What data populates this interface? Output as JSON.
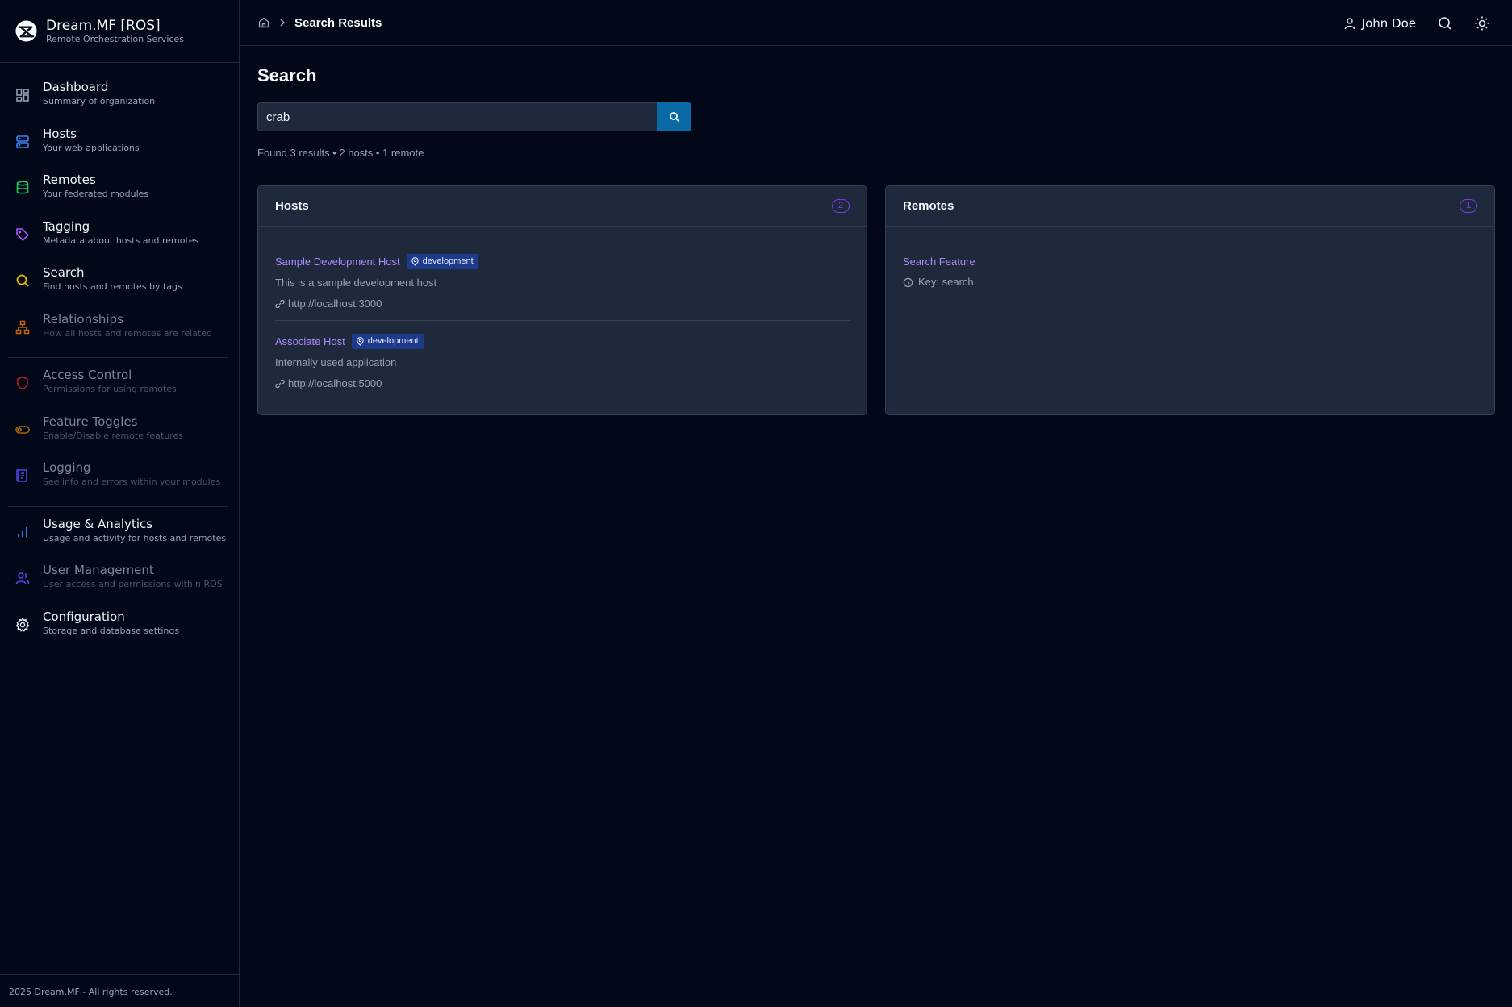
{
  "brand": {
    "title": "Dream.MF [ROS]",
    "subtitle": "Remote Orchestration Services"
  },
  "sidebar": {
    "items": [
      {
        "label": "Dashboard",
        "sub": "Summary of organization",
        "icon": "dashboard-icon",
        "color": "#94a3b8"
      },
      {
        "label": "Hosts",
        "sub": "Your web applications",
        "icon": "server-icon",
        "color": "#3b82f6"
      },
      {
        "label": "Remotes",
        "sub": "Your federated modules",
        "icon": "database-icon",
        "color": "#22c55e"
      },
      {
        "label": "Tagging",
        "sub": "Metadata about hosts and remotes",
        "icon": "tag-icon",
        "color": "#a855f7"
      },
      {
        "label": "Search",
        "sub": "Find hosts and remotes by tags",
        "icon": "search-icon",
        "color": "#eab308"
      },
      {
        "label": "Relationships",
        "sub": "How all hosts and remotes are related",
        "icon": "network-icon",
        "color": "#f97316"
      },
      {
        "label": "Access Control",
        "sub": "Permissions for using remotes",
        "icon": "shield-icon",
        "color": "#ef4444"
      },
      {
        "label": "Feature Toggles",
        "sub": "Enable/Disable remote features",
        "icon": "toggle-icon",
        "color": "#ca8a04"
      },
      {
        "label": "Logging",
        "sub": "See info and errors within your modules",
        "icon": "scroll-icon",
        "color": "#6366f1"
      },
      {
        "label": "Usage & Analytics",
        "sub": "Usage and activity for hosts and remotes",
        "icon": "bar-chart-icon",
        "color": "#3b82f6"
      },
      {
        "label": "User Management",
        "sub": "User access and permissions within ROS",
        "icon": "users-icon",
        "color": "#6366f1"
      },
      {
        "label": "Configuration",
        "sub": "Storage and database settings",
        "icon": "gear-icon",
        "color": "#e2e8f0"
      }
    ],
    "footer": "2025 Dream.MF - All rights reserved."
  },
  "header": {
    "breadcrumb_current": "Search Results",
    "user_name": "John Doe"
  },
  "main": {
    "title": "Search",
    "search": {
      "value": "crab"
    },
    "summary": "Found 3 results • 2 hosts • 1 remote",
    "hosts_card": {
      "title": "Hosts",
      "count": "2",
      "items": [
        {
          "name": "Sample Development Host",
          "tag": "development",
          "description": "This is a sample development host",
          "url": "http://localhost:3000"
        },
        {
          "name": "Associate Host",
          "tag": "development",
          "description": "Internally used application",
          "url": "http://localhost:5000"
        }
      ]
    },
    "remotes_card": {
      "title": "Remotes",
      "count": "1",
      "items": [
        {
          "name": "Search Feature",
          "key": "Key: search"
        }
      ]
    }
  }
}
